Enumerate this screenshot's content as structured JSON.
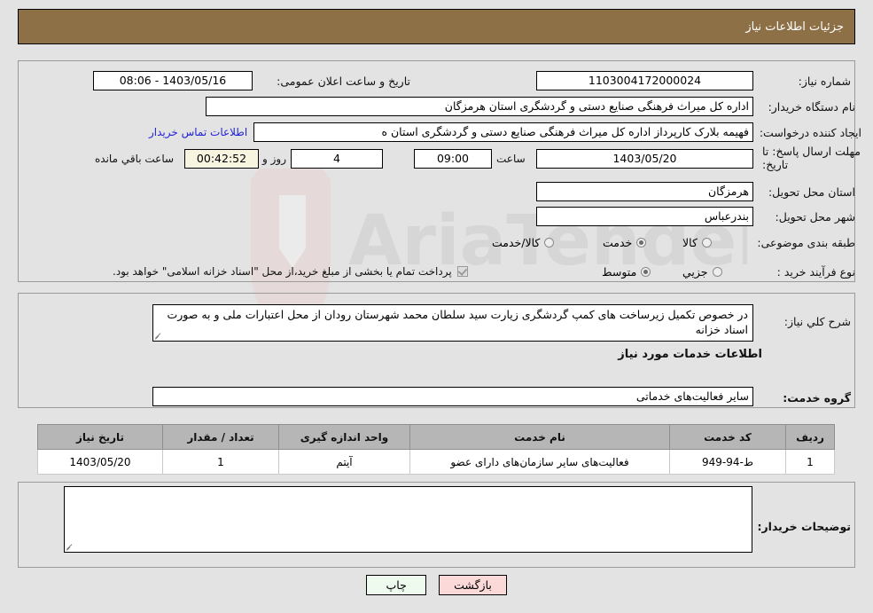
{
  "header": {
    "title": "جزئیات اطلاعات نیاز",
    "bg": "#8d7045",
    "fg": "#ffffff"
  },
  "top_section": {
    "need_number": {
      "label": "شماره نیاز:",
      "value": "1103004172000024"
    },
    "public_announce": {
      "label": "تاریخ و ساعت اعلان عمومی:",
      "value": "1403/05/16 - 08:06"
    },
    "buyer_org": {
      "label": "نام دستگاه خریدار:",
      "value": "اداره کل میراث فرهنگی  صنایع دستی و گردشگری استان هرمزگان"
    },
    "requester": {
      "label": "ایجاد کننده درخواست:",
      "value": "فهیمه بلارک کارپرداز اداره کل میراث فرهنگی  صنایع دستی و گردشگری استان ه",
      "contact_link": "اطلاعات تماس خریدار"
    },
    "deadline": {
      "label": "مهلت ارسال پاسخ: تا تاریخ:",
      "date": "1403/05/20",
      "hour_label": "ساعت",
      "hour": "09:00",
      "days": "4",
      "days_label": "روز و",
      "countdown": "00:42:52",
      "remaining_label": "ساعت باقي مانده"
    },
    "delivery_province": {
      "label": "استان محل تحویل:",
      "value": "هرمزگان"
    },
    "delivery_city": {
      "label": "شهر محل تحویل:",
      "value": "بندرعباس"
    },
    "category": {
      "label": "طبقه بندی موضوعی:",
      "options": [
        {
          "text": "کالا",
          "selected": false
        },
        {
          "text": "خدمت",
          "selected": true
        },
        {
          "text": "کالا/خدمت",
          "selected": false
        }
      ]
    },
    "purchase_process": {
      "label": "نوع فرآیند خرید :",
      "options": [
        {
          "text": "جزیي",
          "selected": false
        },
        {
          "text": "متوسط",
          "selected": true
        }
      ],
      "treasury_checkbox_checked": true,
      "treasury_note": "پرداخت تمام یا بخشی از مبلغ خرید،از محل \"اسناد خزانه اسلامی\" خواهد بود."
    }
  },
  "middle_section": {
    "general_description": {
      "label": "شرح کلي نیاز:",
      "value": "در خصوص تکمیل زیرساخت های کمپ گردشگری زیارت سید سلطان محمد شهرستان رودان از محل اعتبارات ملی و به صورت اسناد خزانه"
    },
    "services_heading": "اطلاعات خدمات مورد نیاز",
    "service_group": {
      "label": "گروه خدمت:",
      "value": "سایر فعالیت‌های خدماتی"
    }
  },
  "table": {
    "columns": [
      "ردیف",
      "کد خدمت",
      "نام خدمت",
      "واحد اندازه گیری",
      "تعداد / مقدار",
      "تاریخ نیاز"
    ],
    "rows": [
      {
        "row_no": "1",
        "service_code": "ط-94-949",
        "service_name": "فعالیت‌های سایر سازمان‌های دارای عضو",
        "unit": "آیتم",
        "quantity": "1",
        "need_date": "1403/05/20"
      }
    ]
  },
  "bottom_section": {
    "buyer_notes": {
      "label": "توضیحات خریدار:",
      "value": ""
    }
  },
  "buttons": {
    "print": {
      "label": "چاپ",
      "bg": "#edfaed"
    },
    "back": {
      "label": "بازگشت",
      "bg": "#fbd9d9"
    }
  },
  "watermark": {
    "text": "AriaTender.net"
  }
}
